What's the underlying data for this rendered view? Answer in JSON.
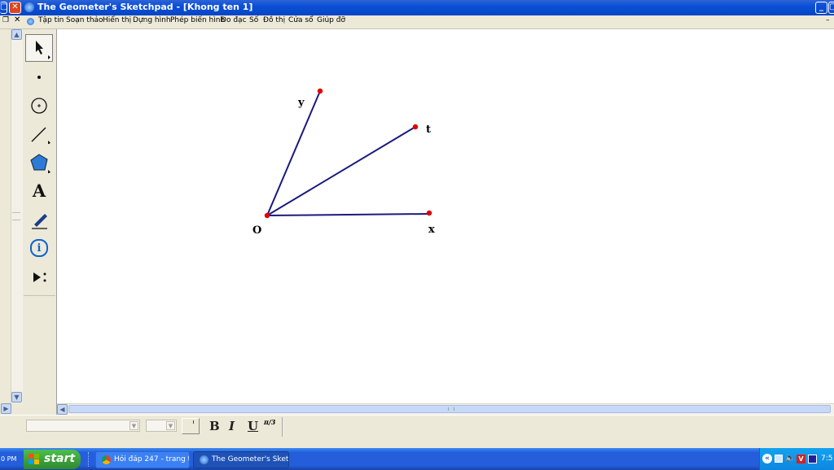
{
  "window": {
    "title": "The Geometer's Sketchpad - [Khong ten 1]"
  },
  "menu": [
    "Tập tin",
    "Soạn thảo",
    "Hiển thị",
    "Dựng hình",
    "Phép biến hình",
    "Đo đạc",
    "Số",
    "Đồ thị",
    "Cửa sổ",
    "Giúp đỡ"
  ],
  "toolbox": {
    "tools": [
      "arrow-tool",
      "point-tool",
      "compass-tool",
      "straightedge-tool",
      "polygon-tool",
      "text-tool",
      "marker-tool",
      "information-tool",
      "custom-tool"
    ],
    "text_tool_glyph": "A",
    "info_tool_glyph": "i"
  },
  "sketch": {
    "line_color": "#1a1a7e",
    "point_color": "#e00000",
    "labels": {
      "O": "O",
      "x": "x",
      "y": "y",
      "t": "t"
    }
  },
  "textbar": {
    "bold": "B",
    "italic": "I",
    "underline": "U",
    "math": "π/3"
  },
  "taskbar": {
    "start": "start",
    "left_clock_fragment": "0 PM",
    "tasks": [
      {
        "label": "Hỏi đáp 247 - trang tr...",
        "active": false
      },
      {
        "label": "The Geometer's Sketc...",
        "active": true
      }
    ],
    "tray_clock": "7:5"
  }
}
